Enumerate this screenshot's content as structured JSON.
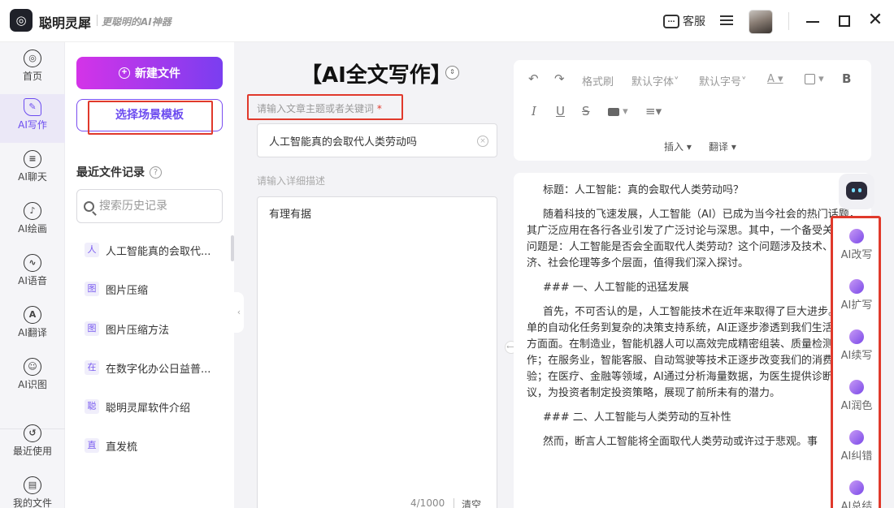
{
  "app": {
    "name": "聪明灵犀",
    "slogan": "更聪明的AI神器",
    "logo_glyph": "◎"
  },
  "header": {
    "service_label": "客服",
    "service_icon_glyph": "…"
  },
  "nav": [
    {
      "label": "首页",
      "icon": "home-icon",
      "glyph": "◎"
    },
    {
      "label": "AI写作",
      "icon": "pen-icon",
      "glyph": "✎"
    },
    {
      "label": "AI聊天",
      "icon": "chat-icon",
      "glyph": "≡"
    },
    {
      "label": "AI绘画",
      "icon": "brush-icon",
      "glyph": "♪"
    },
    {
      "label": "AI语音",
      "icon": "voice-icon",
      "glyph": "∿"
    },
    {
      "label": "AI翻译",
      "icon": "translate-icon",
      "glyph": "A"
    },
    {
      "label": "AI识图",
      "icon": "image-scan-icon",
      "glyph": "☺"
    },
    {
      "label": "最近使用",
      "icon": "clock-icon",
      "glyph": "↺"
    },
    {
      "label": "我的文件",
      "icon": "file-icon",
      "glyph": "▤"
    }
  ],
  "files": {
    "new_label": "新建文件",
    "template_label": "选择场景模板",
    "recent_title": "最近文件记录",
    "search_placeholder": "搜索历史记录",
    "items": [
      {
        "tag": "人",
        "label": "人工智能真的会取代..."
      },
      {
        "tag": "图",
        "label": "图片压缩"
      },
      {
        "tag": "图",
        "label": "图片压缩方法"
      },
      {
        "tag": "在",
        "label": "在数字化办公日益普..."
      },
      {
        "tag": "聪",
        "label": "聪明灵犀软件介绍"
      },
      {
        "tag": "直",
        "label": "直发梳"
      }
    ]
  },
  "input": {
    "title": "【AI全文写作】",
    "topic_label": "请输入文章主题或者关键词",
    "topic_required": "*",
    "topic_value": "人工智能真的会取代人类劳动吗",
    "desc_label": "请输入详细描述",
    "desc_value": "有理有据",
    "count": "4/1000",
    "clear_label": "清空"
  },
  "toolbar": {
    "undo": "↶",
    "redo": "↷",
    "format_painter": "格式刷",
    "font_family": "默认字体",
    "font_size": "默认字号",
    "font_color": "A",
    "bold": "B",
    "italic": "I",
    "underline": "U",
    "strike": "S",
    "align": "≡",
    "insert": "插入",
    "translate": "翻译"
  },
  "editor": {
    "paragraphs": [
      "标题：人工智能：真的会取代人类劳动吗？",
      "随着科技的飞速发展，人工智能（AI）已成为当今社会的热门话题，其广泛应用在各行各业引发了广泛讨论与深思。其中，一个备受关注的问题是：人工智能是否会全面取代人类劳动？这个问题涉及技术、经济、社会伦理等多个层面，值得我们深入探讨。",
      "### 一、人工智能的迅猛发展",
      "首先，不可否认的是，人工智能技术在近年来取得了巨大进步。从简单的自动化任务到复杂的决策支持系统，AI正逐步渗透到我们生活的方方面面。在制造业，智能机器人可以高效完成精密组装、质量检测等工作；在服务业，智能客服、自动驾驶等技术正逐步改变我们的消费体验；在医疗、金融等领域，AI通过分析海量数据，为医生提供诊断建议，为投资者制定投资策略，展现了前所未有的潜力。",
      "### 二、人工智能与人类劳动的互补性",
      "然而，断言人工智能将全面取代人类劳动或许过于悲观。事"
    ]
  },
  "ai_tools": [
    {
      "label": "AI改写",
      "icon": "rewrite-icon"
    },
    {
      "label": "AI扩写",
      "icon": "expand-icon"
    },
    {
      "label": "AI续写",
      "icon": "continue-icon"
    },
    {
      "label": "AI润色",
      "icon": "polish-icon"
    },
    {
      "label": "AI纠错",
      "icon": "correct-icon"
    },
    {
      "label": "AI总结",
      "icon": "summary-icon"
    }
  ]
}
